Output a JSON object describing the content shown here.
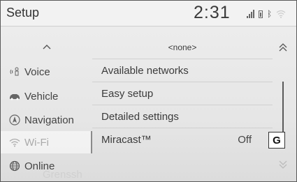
{
  "header": {
    "title": "Setup",
    "clock": "2:31"
  },
  "status_icons": [
    "signal-strength-icon",
    "battery-icon",
    "bluetooth-icon",
    "wifi-icon"
  ],
  "nav": {
    "items": [
      {
        "label": "Voice",
        "icon": "voice-icon",
        "selected": false
      },
      {
        "label": "Vehicle",
        "icon": "car-icon",
        "selected": false
      },
      {
        "label": "Navigation",
        "icon": "navigation-icon",
        "selected": false
      },
      {
        "label": "Wi-Fi",
        "icon": "wifi-icon",
        "selected": true
      },
      {
        "label": "Online",
        "icon": "globe-icon",
        "selected": false
      }
    ]
  },
  "list": {
    "top_row": "<none>",
    "items": [
      {
        "label": "Available networks",
        "value": ""
      },
      {
        "label": "Easy setup",
        "value": ""
      },
      {
        "label": "Detailed settings",
        "value": ""
      },
      {
        "label": "Miracast™",
        "value": "Off"
      }
    ]
  },
  "callout": {
    "label": "G"
  },
  "background_text": "Grenssh"
}
